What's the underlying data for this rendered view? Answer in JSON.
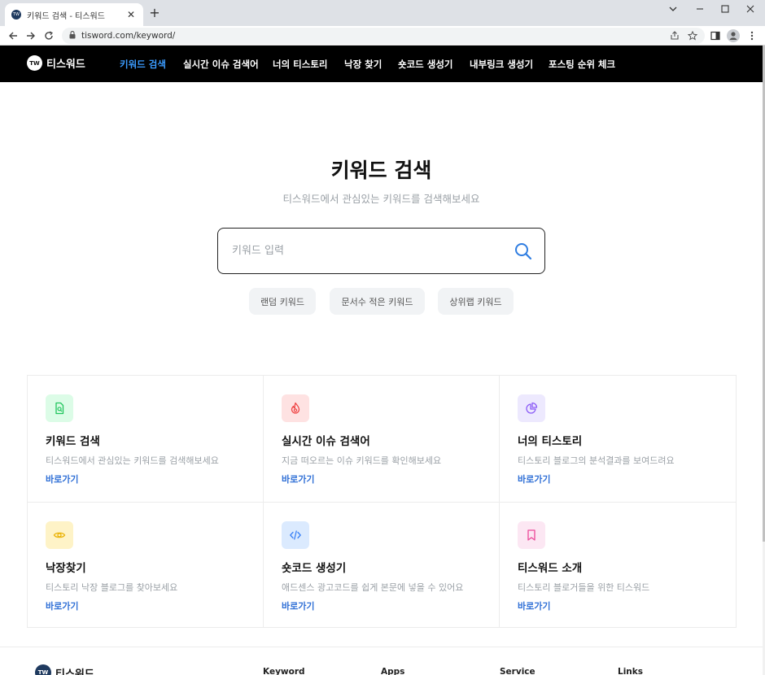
{
  "browser": {
    "tab_title": "키워드 검색 - 티스워드",
    "favicon_text": "TW",
    "url": "tisword.com/keyword/"
  },
  "nav": {
    "logo_badge": "TW",
    "logo_text": "티스워드",
    "items": [
      {
        "label": "키워드 검색",
        "active": true
      },
      {
        "label": "실시간 이슈 검색어",
        "active": false
      },
      {
        "label": "너의 티스토리",
        "active": false
      },
      {
        "label": "낙장 찾기",
        "active": false
      },
      {
        "label": "숏코드 생성기",
        "active": false
      },
      {
        "label": "내부링크 생성기",
        "active": false
      },
      {
        "label": "포스팅 순위 체크",
        "active": false
      }
    ]
  },
  "hero": {
    "title": "키워드 검색",
    "subtitle": "티스워드에서 관심있는 키워드를 검색해보세요"
  },
  "search": {
    "placeholder": "키워드 입력",
    "value": ""
  },
  "chips": [
    {
      "label": "랜덤 키워드"
    },
    {
      "label": "문서수 적은 키워드"
    },
    {
      "label": "상위랩 키워드"
    }
  ],
  "cards": [
    {
      "title": "키워드 검색",
      "desc": "티스워드에서 관심있는 키워드를 검색해보세요",
      "link": "바로가기",
      "icon": "document-search-icon",
      "color": "#22c55e",
      "bg": "#dcfce7"
    },
    {
      "title": "실시간 이슈 검색어",
      "desc": "지금 떠오르는 이슈 키워드를 확인해보세요",
      "link": "바로가기",
      "icon": "fire-icon",
      "color": "#ef4444",
      "bg": "#fee2e2"
    },
    {
      "title": "너의 티스토리",
      "desc": "티스토리 블로그의 분석결과를 보여드려요",
      "link": "바로가기",
      "icon": "pie-chart-icon",
      "color": "#8b5cf6",
      "bg": "#ede9fe"
    },
    {
      "title": "낙장찾기",
      "desc": "티스토리 낙장 블로그를 찾아보세요",
      "link": "바로가기",
      "icon": "eye-icon",
      "color": "#eab308",
      "bg": "#fef3c7"
    },
    {
      "title": "숏코드 생성기",
      "desc": "애드센스 광고코드를 쉽게 본문에 넣을 수 있어요",
      "link": "바로가기",
      "icon": "code-icon",
      "color": "#3b82f6",
      "bg": "#dbeafe"
    },
    {
      "title": "티스워드 소개",
      "desc": "티스토리 블로거들을 위한 티스워드",
      "link": "바로가기",
      "icon": "bookmark-icon",
      "color": "#ec4899",
      "bg": "#fce7f3"
    }
  ],
  "footer": {
    "logo_badge": "TW",
    "logo_text": "티스워드",
    "columns": [
      "Keyword",
      "Apps",
      "Service",
      "Links"
    ]
  }
}
